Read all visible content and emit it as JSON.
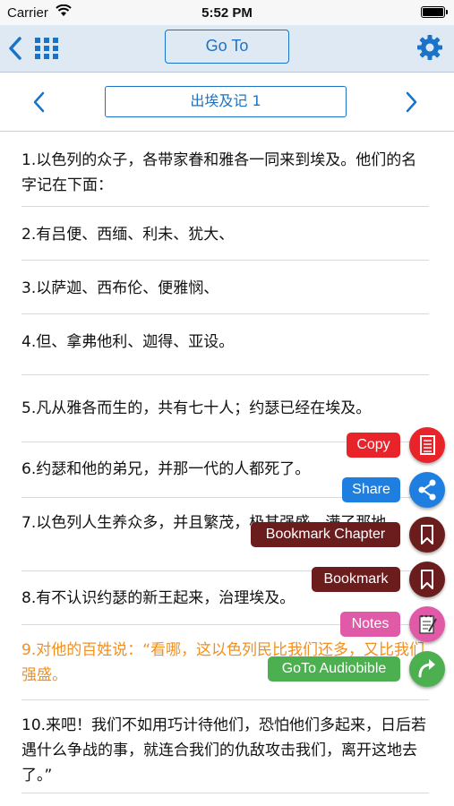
{
  "status": {
    "carrier": "Carrier",
    "time": "5:52 PM"
  },
  "nav": {
    "goto_label": "Go To",
    "accent": "#1a73c8"
  },
  "chapter": {
    "title": "出埃及记 1"
  },
  "verses": [
    {
      "text": "1.以色列的众子，各带家眷和雅各一同来到埃及。他们的名字记在下面："
    },
    {
      "text": "2.有吕便、西缅、利未、犹大、"
    },
    {
      "text": "3.以萨迦、西布伦、便雅悯、"
    },
    {
      "text": "4.但、拿弗他利、迦得、亚设。"
    },
    {
      "text": "5.凡从雅各而生的，共有七十人；约瑟已经在埃及。"
    },
    {
      "text": "6.约瑟和他的弟兄，并那一代的人都死了。"
    },
    {
      "text": "7.以色列人生养众多，并且繁茂，极其强盛，满了那地。"
    },
    {
      "text": "8.有不认识约瑟的新王起来，治理埃及。"
    },
    {
      "text": "9.对他的百姓说：“看哪，这以色列民比我们还多，又比我们强盛。",
      "highlighted": true,
      "color": "#f09020"
    },
    {
      "text": "10.来吧！我们不如用巧计待他们，恐怕他们多起来，日后若遇什么争战的事，就连合我们的仇敌攻击我们，离开这地去了。”"
    }
  ],
  "menu": {
    "copy": {
      "label": "Copy",
      "color": "#e8232a",
      "icon": "copy-icon"
    },
    "share": {
      "label": "Share",
      "color": "#1f7fe0",
      "icon": "share-icon"
    },
    "bookmark_chapter": {
      "label": "Bookmark Chapter",
      "color": "#6b1d1d",
      "icon": "bookmark-icon"
    },
    "bookmark": {
      "label": "Bookmark",
      "color": "#6b1d1d",
      "icon": "bookmark-icon"
    },
    "notes": {
      "label": "Notes",
      "color": "#e05aa8",
      "icon": "notes-icon"
    },
    "audiobible": {
      "label": "GoTo Audiobible",
      "color": "#4caf50",
      "icon": "goto-arrow-icon"
    }
  }
}
